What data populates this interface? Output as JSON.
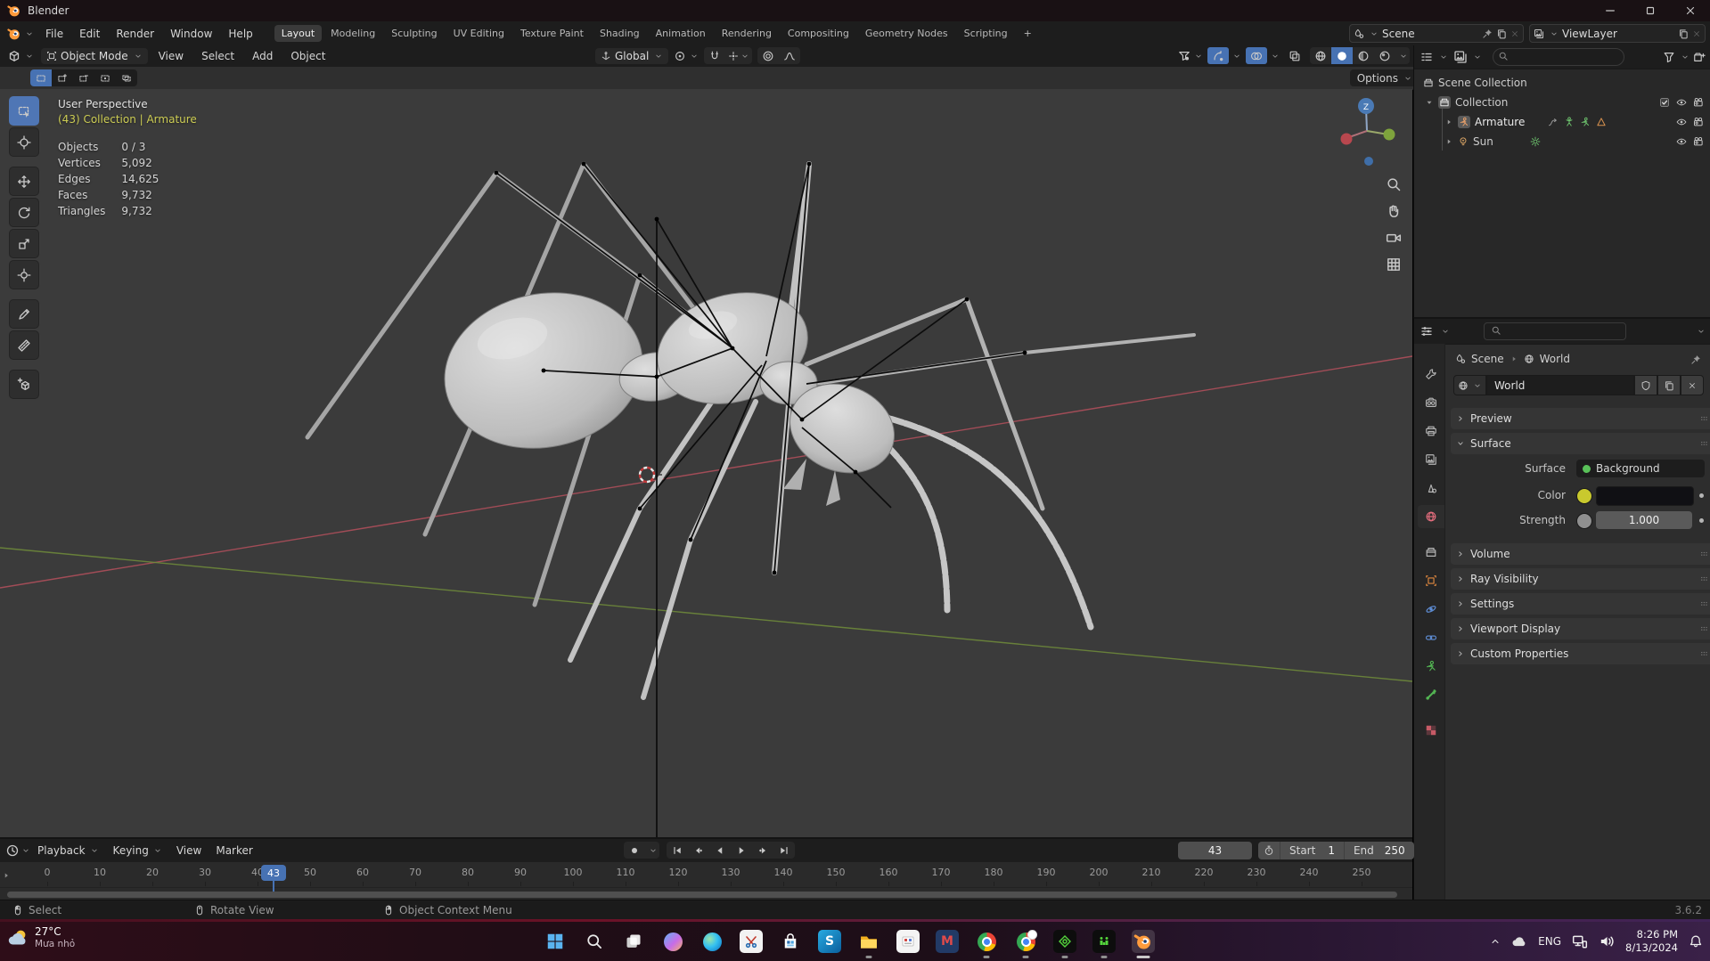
{
  "window": {
    "title": "Blender"
  },
  "topbar": {
    "menus": [
      "File",
      "Edit",
      "Render",
      "Window",
      "Help"
    ],
    "workspaces": [
      "Layout",
      "Modeling",
      "Sculpting",
      "UV Editing",
      "Texture Paint",
      "Shading",
      "Animation",
      "Rendering",
      "Compositing",
      "Geometry Nodes",
      "Scripting"
    ],
    "active_workspace": "Layout",
    "add_workspace": "+",
    "scene_name": "Scene",
    "view_layer_name": "ViewLayer"
  },
  "viewport": {
    "header": {
      "mode": "Object Mode",
      "menus": [
        "View",
        "Select",
        "Add",
        "Object"
      ],
      "orientation": "Global"
    },
    "tool_settings": {
      "options_label": "Options"
    },
    "overlay": {
      "view_name": "User Perspective",
      "active_context": "(43) Collection | Armature",
      "stats": [
        {
          "label": "Objects",
          "value": "0 / 3"
        },
        {
          "label": "Vertices",
          "value": "5,092"
        },
        {
          "label": "Edges",
          "value": "14,625"
        },
        {
          "label": "Faces",
          "value": "9,732"
        },
        {
          "label": "Triangles",
          "value": "9,732"
        }
      ]
    },
    "gizmo_axis_label": "Z"
  },
  "outliner": {
    "rows": [
      {
        "label": "Scene Collection"
      },
      {
        "label": "Collection"
      },
      {
        "label": "Armature"
      },
      {
        "label": "Sun"
      }
    ]
  },
  "properties": {
    "breadcrumb": {
      "scene": "Scene",
      "world": "World"
    },
    "id_name": "World",
    "panels": {
      "preview": "Preview",
      "surface": "Surface",
      "volume": "Volume",
      "ray_visibility": "Ray Visibility",
      "settings": "Settings",
      "viewport_display": "Viewport Display",
      "custom_properties": "Custom Properties"
    },
    "surface": {
      "surface_label": "Surface",
      "surface_value": "Background",
      "color_label": "Color",
      "strength_label": "Strength",
      "strength_value": "1.000"
    }
  },
  "timeline": {
    "menus": [
      "Playback",
      "Keying",
      "View",
      "Marker"
    ],
    "current_frame": "43",
    "frame_field": "43",
    "start_label": "Start",
    "start_value": "1",
    "end_label": "End",
    "end_value": "250",
    "ruler": [
      0,
      10,
      20,
      30,
      40,
      50,
      60,
      70,
      80,
      90,
      100,
      110,
      120,
      130,
      140,
      150,
      160,
      170,
      180,
      190,
      200,
      210,
      220,
      230,
      240,
      250
    ]
  },
  "status_bar": {
    "items": [
      {
        "label": "Select"
      },
      {
        "label": "Rotate View"
      },
      {
        "label": "Object Context Menu"
      }
    ],
    "version": "3.6.2"
  },
  "taskbar": {
    "weather": {
      "temp": "27°C",
      "condition": "Mưa nhỏ"
    },
    "tray": {
      "language": "ENG",
      "time": "8:26 PM",
      "date": "8/13/2024"
    }
  },
  "colors": {
    "accent_blue": "#4772b3",
    "context_yellow": "#cdcd54",
    "header_gray": "#1d1d1d",
    "viewport_gray": "#3b3b3b"
  }
}
